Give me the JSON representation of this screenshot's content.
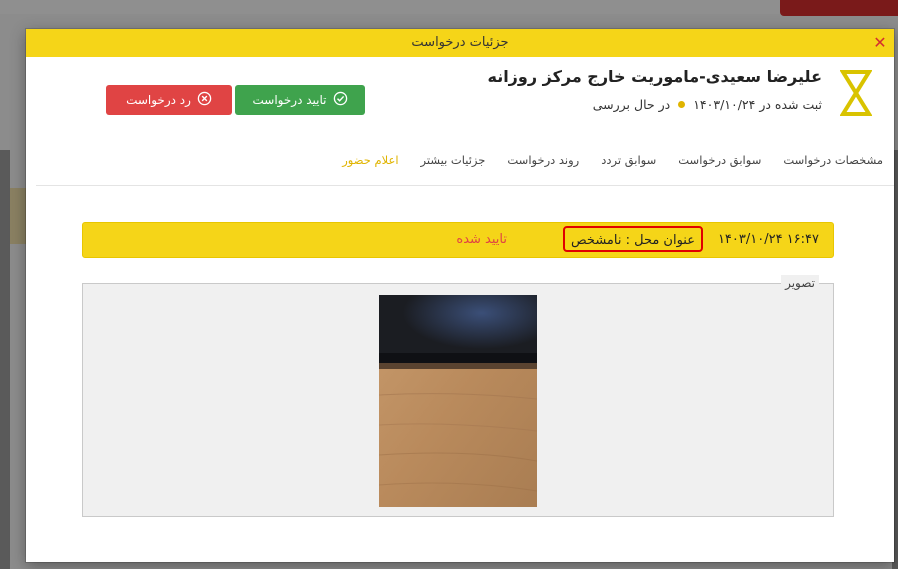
{
  "modal": {
    "title": "جزئیات درخواست",
    "close_icon": "close-icon"
  },
  "request": {
    "title": "علیرضا سعیدی-ماموریت خارج مرکز روزانه",
    "registered_text": "ثبت شده در ۱۴۰۳/۱۰/۲۴",
    "status_text": "در حال بررسی",
    "status_icon": "hourglass-icon",
    "accent_color": "#d9c300"
  },
  "actions": {
    "approve_label": "تایید درخواست",
    "approve_color": "#3fa34d",
    "reject_label": "رد درخواست",
    "reject_color": "#e04444"
  },
  "tabs": [
    {
      "label": "مشخصات درخواست",
      "active": false
    },
    {
      "label": "سوابق درخواست",
      "active": false
    },
    {
      "label": "سوابق تردد",
      "active": false
    },
    {
      "label": "روند درخواست",
      "active": false
    },
    {
      "label": "جزئیات بیشتر",
      "active": false
    },
    {
      "label": "اعلام حضور",
      "active": true
    }
  ],
  "attendance": {
    "datetime": "۱۴۰۳/۱۰/۲۴ ۱۶:۴۷",
    "location_text": "عنوان محل : نامشخص",
    "status_text": "تایید شده",
    "bar_color": "#f5d518"
  },
  "image_section": {
    "legend": "تصویر"
  }
}
